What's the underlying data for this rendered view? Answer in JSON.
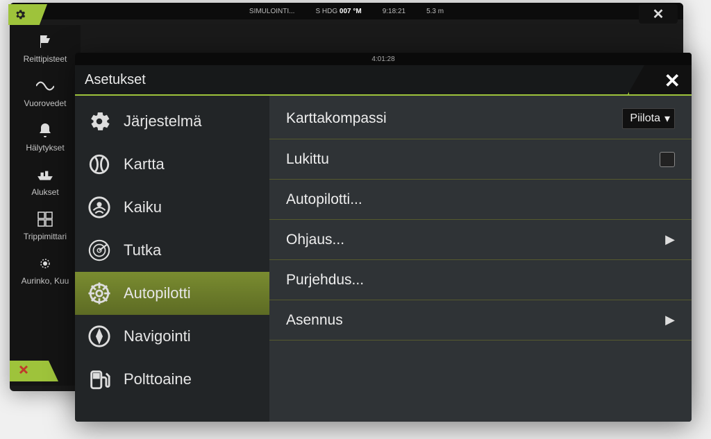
{
  "back": {
    "status": {
      "sim": "SIMULOINTI...",
      "hdg_label": "S HDG",
      "hdg_value": "007 °M",
      "time": "9:18:21",
      "depth": "5.3 m"
    }
  },
  "sidebar": {
    "items": [
      {
        "label": "Reittipisteet"
      },
      {
        "label": "Vuorovedet"
      },
      {
        "label": "Hälytykset"
      },
      {
        "label": "Alukset"
      },
      {
        "label": "Trippimittari"
      },
      {
        "label": "Aurinko, Kuu"
      }
    ]
  },
  "front": {
    "topbar_time": "4:01:28",
    "title": "Asetukset",
    "nav": [
      {
        "label": "Järjestelmä"
      },
      {
        "label": "Kartta"
      },
      {
        "label": "Kaiku"
      },
      {
        "label": "Tutka"
      },
      {
        "label": "Autopilotti"
      },
      {
        "label": "Navigointi"
      },
      {
        "label": "Polttoaine"
      }
    ],
    "detail": {
      "compass_label": "Karttakompassi",
      "compass_value": "Piilota",
      "locked_label": "Lukittu",
      "autopilot_label": "Autopilotti...",
      "steering_label": "Ohjaus...",
      "sailing_label": "Purjehdus...",
      "install_label": "Asennus"
    }
  }
}
